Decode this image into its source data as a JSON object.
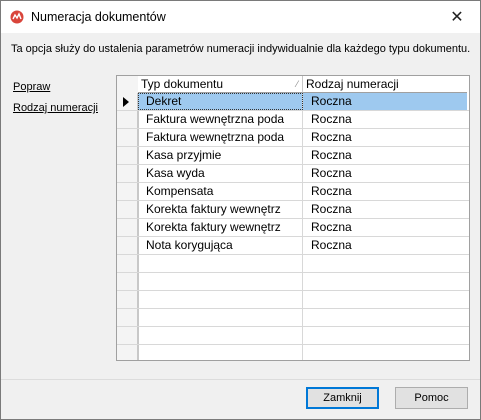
{
  "window": {
    "title": "Numeracja dokumentów"
  },
  "info_text": "Ta opcja służy do ustalenia parametrów numeracji indywidualnie dla każdego typu dokumentu.",
  "side_links": [
    "Popraw",
    "Rodzaj numeracji"
  ],
  "grid": {
    "columns": [
      "Typ dokumentu",
      "Rodzaj numeracji"
    ],
    "rows": [
      [
        "Dekret",
        "Roczna"
      ],
      [
        "Faktura wewnętrzna poda",
        "Roczna"
      ],
      [
        "Faktura wewnętrzna poda",
        "Roczna"
      ],
      [
        "Kasa przyjmie",
        "Roczna"
      ],
      [
        "Kasa wyda",
        "Roczna"
      ],
      [
        "Kompensata",
        "Roczna"
      ],
      [
        "Korekta faktury wewnętrz",
        "Roczna"
      ],
      [
        "Korekta faktury wewnętrz",
        "Roczna"
      ],
      [
        "Nota korygująca",
        "Roczna"
      ]
    ],
    "selected_row": 0,
    "empty_rows": 6
  },
  "buttons": {
    "close": "Zamknij",
    "help": "Pomoc"
  },
  "colors": {
    "selection": "#9ec9ef",
    "accent": "#0078d7"
  }
}
